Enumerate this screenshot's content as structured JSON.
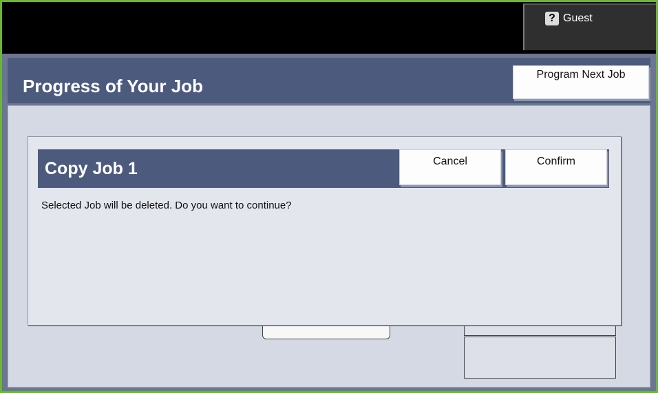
{
  "header": {
    "guest_label": "Guest",
    "help_glyph": "?",
    "help_icon": "question-mark-icon"
  },
  "page": {
    "title": "Progress of Your Job",
    "program_next_job_label": "Program Next Job"
  },
  "dialog": {
    "title": "Copy Job 1",
    "cancel_label": "Cancel",
    "confirm_label": "Confirm",
    "message": "Selected Job will be deleted. Do you want to continue?"
  },
  "colors": {
    "frame_border": "#6db33f",
    "title_bar": "#4c5a7e",
    "panel": "#d5d9e3"
  }
}
